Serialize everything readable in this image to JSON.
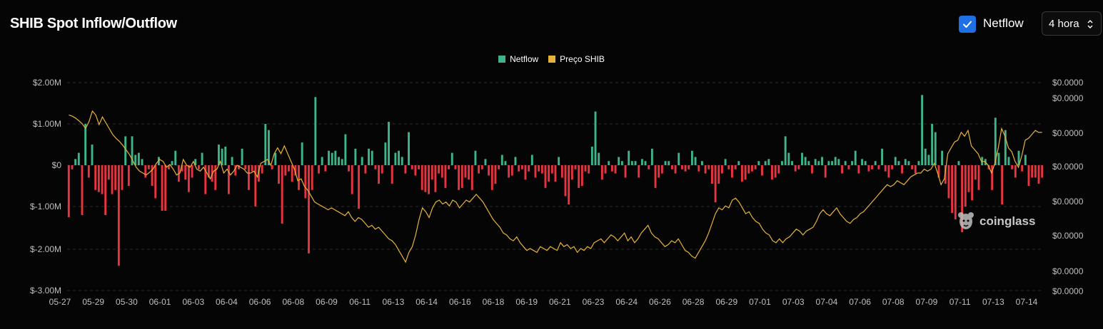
{
  "header": {
    "title": "SHIB Spot Inflow/Outflow",
    "netflow_checkbox_label": "Netflow",
    "netflow_checked": true,
    "interval_select": "4 hora"
  },
  "colors": {
    "positive": "#3eb489",
    "negative": "#e8343f",
    "price_line": "#e6b23a",
    "checkbox": "#1f6fe5",
    "gridline": "#2a2a2a"
  },
  "watermark": "coinglass",
  "chart_data": {
    "type": "bar",
    "legend": [
      "Netflow",
      "Preço SHIB"
    ],
    "legend_position": "top-center",
    "grid": true,
    "y_left": {
      "ticks": [
        "$2.00M",
        "$1.00M",
        "$0",
        "$-1.00M",
        "$-2.00M",
        "$-3.00M"
      ],
      "tick_values": [
        2000000,
        1000000,
        0,
        -1000000,
        -2000000,
        -3000000
      ],
      "ylim": [
        -3000000,
        2000000
      ]
    },
    "y_right": {
      "ticks": [
        "$0.0000",
        "$0.0000",
        "$0.0000",
        "$0.0000",
        "$0.0000",
        "$0.0000",
        "$0.0000",
        "$0.0000"
      ]
    },
    "x_ticks": [
      "05-27",
      "05-29",
      "05-30",
      "06-01",
      "06-03",
      "06-04",
      "06-06",
      "06-08",
      "06-09",
      "06-11",
      "06-13",
      "06-14",
      "06-16",
      "06-18",
      "06-19",
      "06-21",
      "06-23",
      "06-24",
      "06-26",
      "06-28",
      "06-29",
      "07-01",
      "07-03",
      "07-04",
      "07-06",
      "07-08",
      "07-09",
      "07-11",
      "07-13",
      "07-14"
    ],
    "series": [
      {
        "name": "Netflow",
        "unit": "USD",
        "values": [
          -1250000,
          -100000,
          150000,
          300000,
          -1200000,
          1000000,
          -300000,
          500000,
          -600000,
          -650000,
          -700000,
          -1200000,
          -350000,
          -700000,
          -600000,
          -2400000,
          -600000,
          700000,
          -500000,
          700000,
          250000,
          300000,
          150000,
          -300000,
          -100000,
          -500000,
          -800000,
          200000,
          -1100000,
          -1100000,
          -100000,
          100000,
          350000,
          -400000,
          -150000,
          -350000,
          -650000,
          -300000,
          150000,
          -100000,
          300000,
          -700000,
          -300000,
          -400000,
          -600000,
          500000,
          400000,
          450000,
          -700000,
          200000,
          -250000,
          -100000,
          400000,
          -100000,
          -600000,
          -150000,
          -1000000,
          -400000,
          -200000,
          1000000,
          850000,
          -100000,
          300000,
          -450000,
          -1400000,
          -250000,
          -150000,
          -400000,
          -250000,
          -600000,
          550000,
          -800000,
          -2100000,
          -600000,
          1650000,
          -200000,
          200000,
          -150000,
          350000,
          300000,
          350000,
          200000,
          150000,
          750000,
          -150000,
          -700000,
          400000,
          -1050000,
          200000,
          -200000,
          400000,
          350000,
          -100000,
          -450000,
          -200000,
          550000,
          1050000,
          -450000,
          300000,
          350000,
          200000,
          -200000,
          800000,
          -100000,
          -250000,
          -100000,
          -600000,
          -650000,
          -700000,
          -350000,
          -650000,
          -200000,
          -300000,
          -550000,
          -100000,
          300000,
          -100000,
          -600000,
          -550000,
          -300000,
          -350000,
          -600000,
          350000,
          -200000,
          -100000,
          150000,
          -250000,
          -600000,
          -450000,
          -100000,
          250000,
          100000,
          -300000,
          -250000,
          200000,
          -150000,
          -100000,
          -350000,
          -150000,
          250000,
          -300000,
          -150000,
          -200000,
          -550000,
          -400000,
          -200000,
          -400000,
          200000,
          -300000,
          -750000,
          -950000,
          -350000,
          -100000,
          -550000,
          -500000,
          -150000,
          -200000,
          450000,
          1300000,
          300000,
          -350000,
          -200000,
          100000,
          -150000,
          -200000,
          200000,
          100000,
          -300000,
          350000,
          100000,
          100000,
          -300000,
          150000,
          100000,
          -100000,
          400000,
          -550000,
          -300000,
          -200000,
          100000,
          100000,
          -100000,
          -200000,
          300000,
          -100000,
          -150000,
          -100000,
          350000,
          200000,
          -150000,
          100000,
          -200000,
          -100000,
          -450000,
          -900000,
          -450000,
          -200000,
          150000,
          -100000,
          -300000,
          -100000,
          100000,
          -400000,
          -350000,
          -200000,
          -150000,
          -100000,
          100000,
          -250000,
          100000,
          150000,
          -350000,
          -300000,
          -200000,
          100000,
          700000,
          300000,
          100000,
          -150000,
          -100000,
          300000,
          200000,
          100000,
          -200000,
          150000,
          100000,
          200000,
          -300000,
          100000,
          100000,
          200000,
          150000,
          -200000,
          100000,
          -100000,
          100000,
          350000,
          -200000,
          150000,
          100000,
          -150000,
          -100000,
          100000,
          -100000,
          400000,
          -150000,
          -300000,
          -100000,
          200000,
          100000,
          -200000,
          150000,
          100000,
          -100000,
          -200000,
          100000,
          1700000,
          400000,
          250000,
          1000000,
          800000,
          -300000,
          350000,
          -450000,
          -800000,
          -1150000,
          -1300000,
          100000,
          -1600000,
          -1000000,
          -650000,
          -850000,
          -350000,
          -600000,
          200000,
          150000,
          -100000,
          -600000,
          1150000,
          300000,
          -950000,
          850000,
          200000,
          -100000,
          -300000,
          350000,
          -150000,
          250000,
          -500000,
          -300000,
          -300000,
          -450000,
          -300000
        ]
      },
      {
        "name": "Preço SHIB",
        "unit": "USD",
        "values": [
          1.2,
          1.17,
          1.12,
          1.05,
          0.97,
          0.85,
          1.03,
          1.3,
          1.2,
          0.95,
          1.15,
          1.0,
          0.85,
          0.7,
          0.6,
          0.52,
          0.42,
          0.3,
          0.18,
          0.02,
          -0.15,
          -0.25,
          -0.3,
          -0.35,
          -0.28,
          -0.2,
          -0.05,
          0.05,
          0.0,
          -0.15,
          -0.08,
          -0.2,
          -0.35,
          -0.3,
          0.05,
          -0.1,
          -0.15,
          0.0,
          -0.2,
          -0.25,
          -0.15,
          -0.3,
          -0.45,
          -0.25,
          -0.2,
          0.0,
          -0.3,
          -0.2,
          -0.35,
          -0.25,
          -0.1,
          -0.15,
          -0.2,
          -0.3,
          -0.3,
          -0.25,
          -0.4,
          -0.05,
          0.0,
          0.05,
          -0.1,
          0.2,
          0.35,
          0.2,
          0.4,
          0.2,
          0.0,
          -0.2,
          -0.5,
          -0.45,
          -0.65,
          -0.75,
          -0.9,
          -1.05,
          -1.1,
          -1.15,
          -1.2,
          -1.25,
          -1.2,
          -1.25,
          -1.3,
          -1.35,
          -1.4,
          -1.3,
          -1.45,
          -1.55,
          -1.45,
          -1.5,
          -1.6,
          -1.7,
          -1.65,
          -1.75,
          -1.7,
          -1.8,
          -1.9,
          -2.0,
          -2.05,
          -2.15,
          -2.3,
          -2.45,
          -2.6,
          -2.35,
          -2.2,
          -1.9,
          -1.5,
          -1.2,
          -1.3,
          -1.45,
          -1.2,
          -1.05,
          -1.0,
          -1.1,
          -1.05,
          -1.15,
          -1.0,
          -1.05,
          -1.2,
          -1.1,
          -1.0,
          -1.05,
          -0.95,
          -0.85,
          -0.95,
          -1.05,
          -1.2,
          -1.35,
          -1.5,
          -1.6,
          -1.7,
          -1.85,
          -1.9,
          -2.0,
          -2.05,
          -1.95,
          -2.1,
          -2.2,
          -2.3,
          -2.25,
          -2.3,
          -2.35,
          -2.2,
          -2.25,
          -2.3,
          -2.2,
          -2.25,
          -2.3,
          -2.1,
          -2.2,
          -2.15,
          -2.25,
          -2.2,
          -2.35,
          -2.25,
          -2.3,
          -2.2,
          -2.25,
          -2.1,
          -2.05,
          -2.0,
          -2.1,
          -2.0,
          -1.9,
          -1.95,
          -2.05,
          -1.95,
          -1.85,
          -2.05,
          -1.95,
          -2.1,
          -2.0,
          -1.85,
          -1.75,
          -1.65,
          -1.85,
          -1.95,
          -2.0,
          -2.1,
          -2.2,
          -2.15,
          -2.05,
          -2.1,
          -2.0,
          -2.15,
          -2.3,
          -2.35,
          -2.45,
          -2.5,
          -2.35,
          -2.2,
          -2.05,
          -1.85,
          -1.6,
          -1.35,
          -1.2,
          -1.25,
          -1.15,
          -1.2,
          -1.0,
          -0.95,
          -1.05,
          -1.2,
          -1.35,
          -1.3,
          -1.45,
          -1.55,
          -1.6,
          -1.75,
          -1.85,
          -1.9,
          -2.05,
          -2.1,
          -2.0,
          -2.1,
          -2.0,
          -1.95,
          -1.85,
          -1.75,
          -1.8,
          -1.9,
          -1.8,
          -1.75,
          -1.7,
          -1.55,
          -1.35,
          -1.25,
          -1.35,
          -1.4,
          -1.3,
          -1.2,
          -1.35,
          -1.45,
          -1.55,
          -1.6,
          -1.5,
          -1.45,
          -1.35,
          -1.3,
          -1.2,
          -1.1,
          -1.0,
          -0.9,
          -0.8,
          -0.7,
          -0.6,
          -0.65,
          -0.6,
          -0.5,
          -0.55,
          -0.6,
          -0.5,
          -0.4,
          -0.35,
          -0.3,
          -0.3,
          -0.2,
          -0.25,
          -0.2,
          -0.05,
          -0.3,
          -0.6,
          -0.45,
          0.2,
          0.35,
          0.5,
          0.55,
          0.75,
          0.65,
          0.8,
          0.4,
          0.3,
          0.2,
          0.0,
          0.0,
          -0.1,
          -0.3,
          -0.05,
          0.35,
          0.85,
          0.65,
          0.35,
          0.25,
          0.0,
          -0.15,
          0.15,
          0.55,
          0.6,
          0.7,
          0.8,
          0.75,
          0.75
        ]
      }
    ]
  }
}
